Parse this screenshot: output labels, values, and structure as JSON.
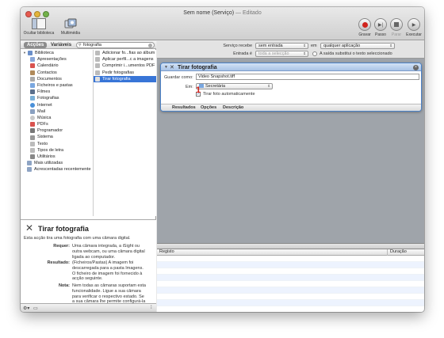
{
  "window": {
    "title": "Sem nome (Serviço)",
    "title_suffix": "— Editado"
  },
  "toolbar": {
    "hide_library": "Ocultar biblioteca",
    "media": "Multimédia",
    "record": "Gravar",
    "step": "Passo",
    "stop": "Parar",
    "run": "Executar"
  },
  "left": {
    "tab_actions": "Acções",
    "tab_variables": "Variáveis",
    "search_value": "fotografia",
    "library": [
      {
        "label": "Biblioteca",
        "icon": "library-icon",
        "color": "#6b8fc9"
      },
      {
        "label": "Apresentações",
        "icon": "presentation-icon",
        "color": "#8aa7d8"
      },
      {
        "label": "Calendário",
        "icon": "calendar-icon",
        "color": "#d9534f"
      },
      {
        "label": "Contactos",
        "icon": "contacts-icon",
        "color": "#b08a5a"
      },
      {
        "label": "Documentos",
        "icon": "documents-icon",
        "color": "#aaaaaa"
      },
      {
        "label": "Ficheiros e pastas",
        "icon": "folder-icon",
        "color": "#7aa7e0"
      },
      {
        "label": "Filmes",
        "icon": "movies-icon",
        "color": "#5a6f8c"
      },
      {
        "label": "Fotografias",
        "icon": "photos-icon",
        "color": "#7ab0d8"
      },
      {
        "label": "Internet",
        "icon": "internet-icon",
        "color": "#4a90d9"
      },
      {
        "label": "Mail",
        "icon": "mail-icon",
        "color": "#8aa0c0"
      },
      {
        "label": "Música",
        "icon": "music-icon",
        "color": "#c9c9c9"
      },
      {
        "label": "PDFs",
        "icon": "pdf-icon",
        "color": "#d9534f"
      },
      {
        "label": "Programador",
        "icon": "developer-icon",
        "color": "#777777"
      },
      {
        "label": "Sistema",
        "icon": "system-icon",
        "color": "#999999"
      },
      {
        "label": "Texto",
        "icon": "text-icon",
        "color": "#bbbbbb"
      },
      {
        "label": "Tipos de letra",
        "icon": "fonts-icon",
        "color": "#bbbbbb"
      },
      {
        "label": "Utilitários",
        "icon": "utilities-icon",
        "color": "#888888"
      }
    ],
    "most_used": "Mais utilizadas",
    "recent": "Acrescentadas recentemente",
    "actions": [
      {
        "label": "Adicionar fo...fias ao álbum",
        "selected": false
      },
      {
        "label": "Aplicar perfil...c a imagens",
        "selected": false
      },
      {
        "label": "Comprimir i...umentos PDF",
        "selected": false
      },
      {
        "label": "Pedir fotografias",
        "selected": false
      },
      {
        "label": "Tirar fotografia",
        "selected": true
      }
    ]
  },
  "description": {
    "title": "Tirar fotografia",
    "subtitle": "Esta acção tira uma fotografia com uma câmara digital.",
    "requires_label": "Requer:",
    "requires_value": "Uma câmara integrada, a iSight ou outra webcam, ou uma câmara digital ligada ao computador.",
    "result_label": "Resultado:",
    "result_value": "(Ficheiros/Pastas) A imagem foi descarregada para a pasta Imagens. O ficheiro de imagem foi fornecido à acção seguinte.",
    "note_label": "Nota:",
    "note_value": "Nem todas as câmaras suportam esta funcionalidade. Ligue a sua câmara para verificar o respectivo estado. Se a sua câmara lhe permite configurá-la para uma ligação USB, escolha PTP."
  },
  "service": {
    "receives_label": "Serviço recebe",
    "receives_value": "sem entrada",
    "in_label": "em",
    "in_value": "qualquer aplicação",
    "input_is_label": "Entrada é",
    "input_is_value": "toda a selecção",
    "replace_label": "A saída substitui o texto seleccionado"
  },
  "card": {
    "title": "Tirar fotografia",
    "save_as_label": "Guardar como:",
    "save_as_value": "Video Snapshot.tiff",
    "where_label": "Em:",
    "where_value": "Secretária",
    "auto_label": "Tirar foto automaticamente",
    "auto_checked": "✓",
    "tab_results": "Resultados",
    "tab_options": "Opções",
    "tab_description": "Descrição",
    "badge": "1"
  },
  "log": {
    "col_log": "Registo",
    "col_duration": "Duração"
  },
  "colors": {
    "accent": "#3875d7",
    "record_red": "#d0231c"
  }
}
